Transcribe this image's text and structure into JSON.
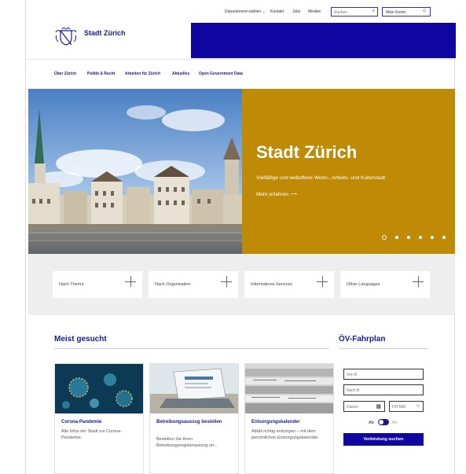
{
  "utility": {
    "department": "Departement wählen",
    "contact": "Kontakt",
    "jobs": "Jobs",
    "media": "Medien",
    "search_placeholder": "Suchen",
    "account": "Mein Konto"
  },
  "header": {
    "site_title": "Stadt Zürich"
  },
  "nav": {
    "items": [
      "Über Zürich",
      "Politik & Recht",
      "Arbeiten für Zürich",
      "Aktuelles",
      "Open Government Data"
    ]
  },
  "hero": {
    "title": "Stadt Zürich",
    "subtitle": "Vielfältige und weltoffene Wohn-, Arbeits- und Kulturstadt",
    "link": "Mehr erfahren",
    "link_arrow": "⟶",
    "slides": 6,
    "active_slide": 1,
    "panel_color": "#bf8a05",
    "brand_blue": "#0f05a0"
  },
  "filters": [
    "Nach Thema",
    "Nach Organisation",
    "Informations-Services",
    "Other Languages"
  ],
  "most_searched": {
    "title": "Meist gesucht",
    "cards": [
      {
        "title": "Corona-Pandemie",
        "text": "Alle Infos der Stadt zur Corona-Pandemie."
      },
      {
        "title": "Betreibungsauszug bestellen",
        "text": "Bestellen Sie Ihren Betreibungsregisterauszug on..."
      },
      {
        "title": "Entsorgungskalender",
        "text": "Abfall richtig entsorgen – mit dem persönlichen Entsorgungskalender."
      }
    ]
  },
  "timetable": {
    "title": "ÖV-Fahrplan",
    "from_placeholder": "Von A",
    "to_placeholder": "Nach B",
    "date_placeholder": "Datum",
    "time_placeholder": "HH:MM",
    "toggle_departure": "Ab",
    "toggle_arrival": "An",
    "search_button": "Verbindung suchen"
  }
}
